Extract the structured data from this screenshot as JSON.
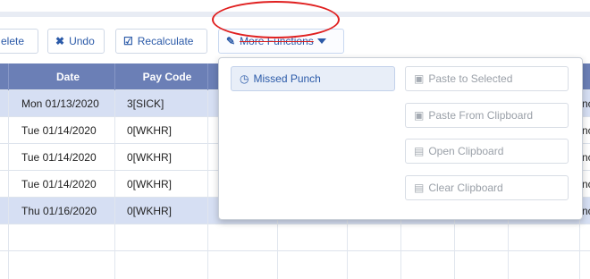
{
  "toolbar": {
    "delete_label": "elete",
    "undo_icon": "✖",
    "undo_label": "Undo",
    "recalc_icon": "☑",
    "recalc_label": "Recalculate",
    "more_icon": "✎",
    "more_label": "More Functions"
  },
  "table": {
    "headers": {
      "date": "Date",
      "pay_code": "Pay Code"
    },
    "rows": [
      {
        "date": "Mon 01/13/2020",
        "pay_code": "3[SICK]",
        "tail": "nc"
      },
      {
        "date": "Tue 01/14/2020",
        "pay_code": "0[WKHR]",
        "tail": "nc"
      },
      {
        "date": "Tue 01/14/2020",
        "pay_code": "0[WKHR]",
        "tail": "nc"
      },
      {
        "date": "Tue 01/14/2020",
        "pay_code": "0[WKHR]",
        "tail": "nc"
      },
      {
        "date": "Thu 01/16/2020",
        "pay_code": "0[WKHR]",
        "tail": "nc"
      }
    ]
  },
  "menu": {
    "missed_punch": {
      "icon": "◷",
      "label": "Missed Punch"
    },
    "paste_selected": {
      "icon": "▣",
      "label": "Paste to Selected"
    },
    "paste_clipboard": {
      "icon": "▣",
      "label": "Paste From Clipboard"
    },
    "open_clipboard": {
      "icon": "▤",
      "label": "Open Clipboard"
    },
    "clear_clipboard": {
      "icon": "▤",
      "label": "Clear Clipboard"
    }
  },
  "colors": {
    "accent": "#2b5aa8",
    "header_bg": "#6b7fb6",
    "selected_row": "#d6dff3",
    "annotation": "#e02020"
  }
}
